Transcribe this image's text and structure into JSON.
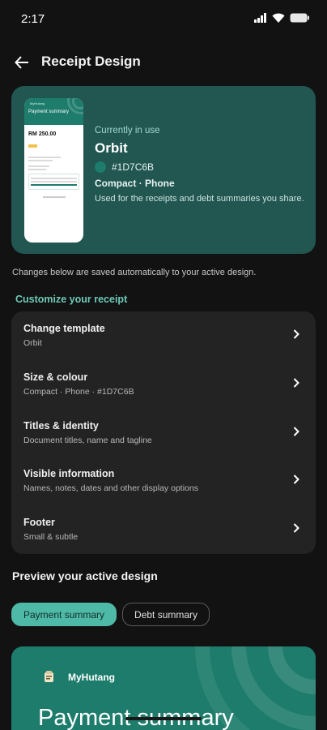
{
  "status_bar": {
    "time": "2:17"
  },
  "app_bar": {
    "title": "Receipt Design"
  },
  "current_design": {
    "label": "Currently in use",
    "name": "Orbit",
    "color_hex": "#1D7C6B",
    "size": "Compact · Phone",
    "description": "Used for the receipts and debt summaries you share."
  },
  "thumbnail": {
    "brand": "MyHutang",
    "title": "Payment summary",
    "amount": "RM 250.00"
  },
  "note": "Changes below are saved automatically to your active design.",
  "customize": {
    "title": "Customize your receipt",
    "items": [
      {
        "title": "Change template",
        "subtitle": "Orbit"
      },
      {
        "title": "Size & colour",
        "subtitle": "Compact · Phone · #1D7C6B"
      },
      {
        "title": "Titles & identity",
        "subtitle": "Document titles, name and tagline"
      },
      {
        "title": "Visible information",
        "subtitle": "Names, notes, dates and other display options"
      },
      {
        "title": "Footer",
        "subtitle": "Small & subtle"
      }
    ]
  },
  "preview": {
    "title": "Preview your active design",
    "tabs": [
      {
        "label": "Payment summary"
      },
      {
        "label": "Debt summary"
      }
    ],
    "selected_tab": "Payment summary",
    "brand": "MyHutang",
    "heading": "Payment summary"
  },
  "colors": {
    "accent": "#1D7C6B",
    "hero_bg": "#215651",
    "section_title": "#6ec9b7",
    "chip_active": "#4fb9a8"
  }
}
